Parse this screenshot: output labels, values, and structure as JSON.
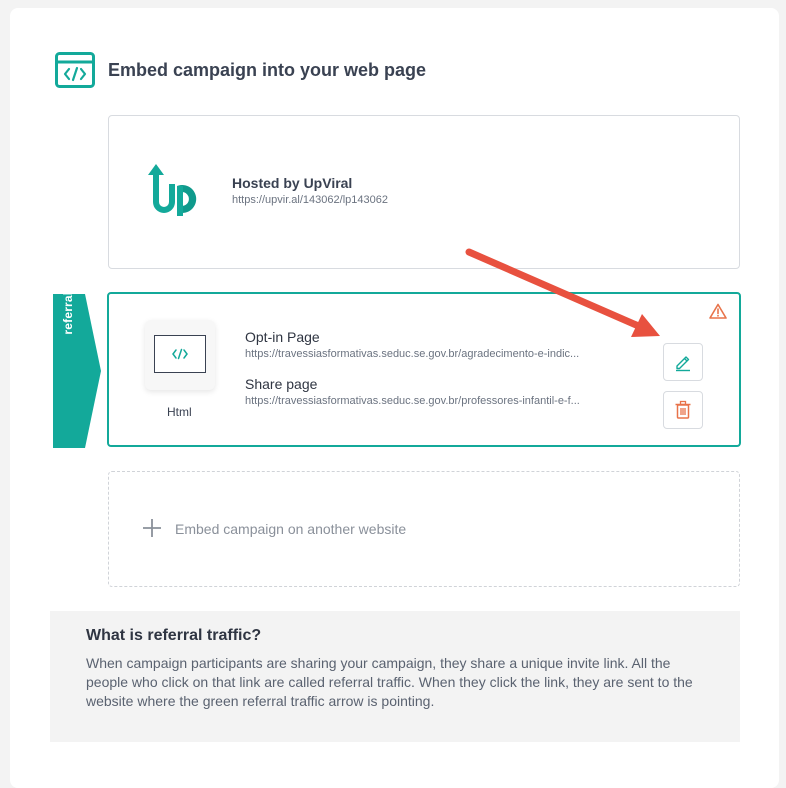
{
  "header": {
    "title": "Embed campaign into your web page",
    "icon": "embed-code-icon"
  },
  "hosted": {
    "title": "Hosted by UpViral",
    "url": "https://upvir.al/143062/lp143062",
    "logo": "upviral-logo"
  },
  "referral_tab": {
    "label": "referral traffic",
    "color": "#13a99a"
  },
  "embed": {
    "type_label": "Html",
    "optin_title": "Opt-in Page",
    "optin_url": "https://travessiasformativas.seduc.se.gov.br/agradecimento-e-indic...",
    "share_title": "Share page",
    "share_url": "https://travessiasformativas.seduc.se.gov.br/professores-infantil-e-f...",
    "warning_icon": "warning-icon",
    "edit_icon": "pencil-icon",
    "delete_icon": "trash-icon"
  },
  "add_embed": {
    "label": "Embed campaign on another website"
  },
  "info": {
    "title": "What is referral traffic?",
    "text": "When campaign participants are sharing your campaign, they share a unique invite link. All the people who click on that link are called referral traffic. When they click the link, they are sent to the website where the green referral traffic arrow is pointing."
  },
  "colors": {
    "accent": "#13a99a",
    "danger": "#e8734a",
    "arrow": "#e8513f"
  }
}
